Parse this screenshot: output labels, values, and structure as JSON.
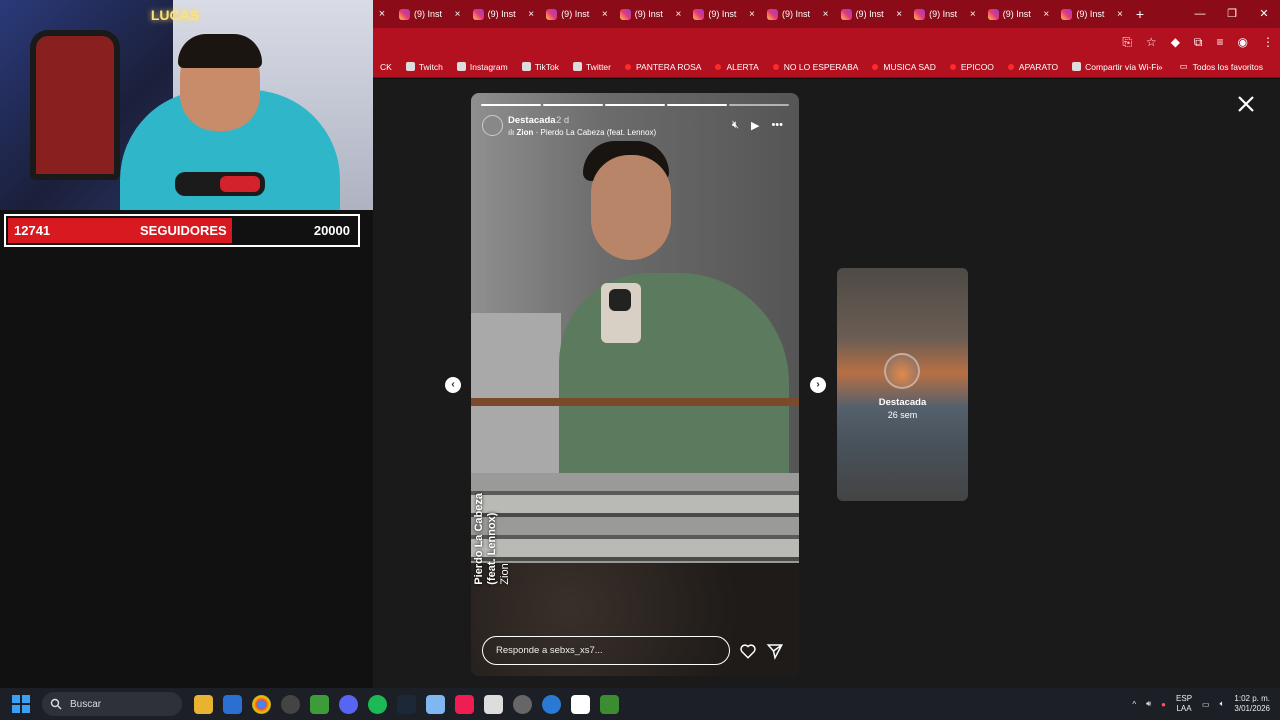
{
  "stream": {
    "sign_text": "LUCAS",
    "followers_current": "12741",
    "followers_label": "SEGUIDORES",
    "followers_goal": "20000",
    "progress": 0.637
  },
  "browser": {
    "lead_close": "×",
    "tabs": [
      {
        "label": "(9) Inst"
      },
      {
        "label": "(9) Inst"
      },
      {
        "label": "(9) Inst"
      },
      {
        "label": "(9) Inst"
      },
      {
        "label": "(9) Inst"
      },
      {
        "label": "(9) Inst"
      },
      {
        "label": "(9) Inst"
      },
      {
        "label": "(9) Inst"
      },
      {
        "label": "(9) Inst"
      },
      {
        "label": "(9) Inst"
      }
    ],
    "new_tab": "+",
    "bookmarks": [
      {
        "label": "CK"
      },
      {
        "label": "Twitch",
        "icon": "twitch-icon"
      },
      {
        "label": "Instagram",
        "icon": "instagram-icon"
      },
      {
        "label": "TikTok",
        "icon": "tiktok-icon"
      },
      {
        "label": "Twitter",
        "icon": "x-icon"
      },
      {
        "label": "PANTERA ROSA",
        "icon": "youtube-icon"
      },
      {
        "label": "ALERTA",
        "icon": "youtube-icon"
      },
      {
        "label": "NO LO ESPERABA",
        "icon": "youtube-icon"
      },
      {
        "label": "MUSICA SAD",
        "icon": "youtube-icon"
      },
      {
        "label": "EPICOO",
        "icon": "youtube-icon"
      },
      {
        "label": "APARATO",
        "icon": "youtube-icon"
      },
      {
        "label": "Compartir vía Wi-Fi",
        "icon": "share-icon"
      }
    ],
    "bookmarks_more": "»",
    "all_bookmarks": "Todos los favoritos"
  },
  "story": {
    "username": "Destacada",
    "time": "2 d",
    "music_artist": "Zion",
    "music_title": "· Pierdo La Cabeza (feat. Lennox)",
    "sticker_title": "Pierdo La Cabeza",
    "sticker_feat": "(feat. Lennox)",
    "sticker_artist": "Zion",
    "reply_placeholder": "Responde a sebxs_xs7..."
  },
  "next_story": {
    "title": "Destacada",
    "subtitle": "26 sem"
  },
  "taskbar": {
    "search_label": "Buscar",
    "lang_1": "ESP",
    "lang_2": "LAA",
    "time": "1:02 p. m.",
    "date": "3/01/2026"
  },
  "colors": {
    "tabstrip": "#8b0c18",
    "toolbar": "#b3111f",
    "follow_fill": "#d91920"
  }
}
